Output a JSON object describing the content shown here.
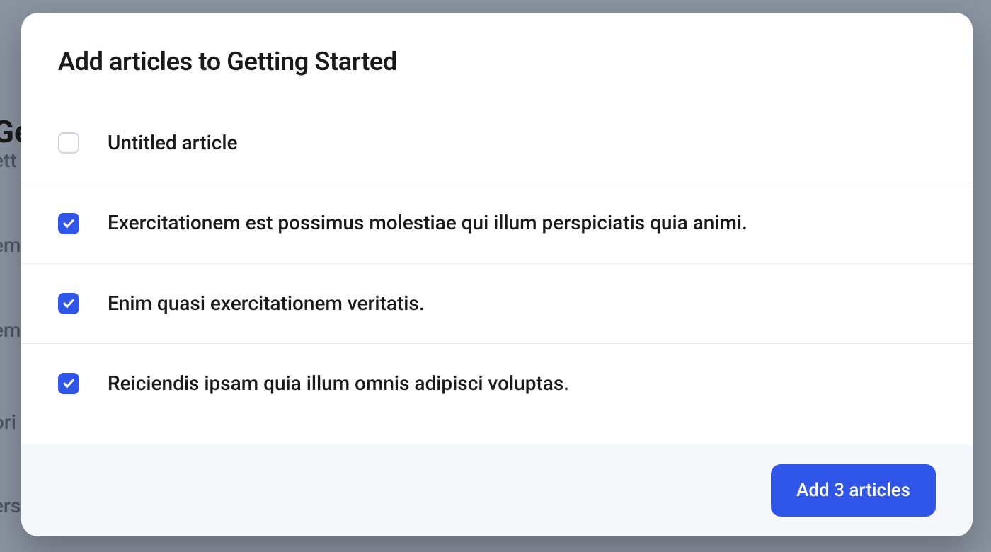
{
  "dialog": {
    "title": "Add articles to Getting Started"
  },
  "articles": [
    {
      "title": "Untitled article",
      "checked": false
    },
    {
      "title": "Exercitationem est possimus molestiae qui illum perspiciatis quia animi.",
      "checked": true
    },
    {
      "title": "Enim quasi exercitationem veritatis.",
      "checked": true
    },
    {
      "title": "Reiciendis ipsam quia illum omnis adipisci voluptas.",
      "checked": true
    }
  ],
  "footer": {
    "add_button_label": "Add 3 articles"
  },
  "backdrop": {
    "heading": "Ge",
    "line1": "ett",
    "line2": "em",
    "line3": "em",
    "line4": "ori",
    "line5": "ers"
  },
  "colors": {
    "primary": "#2f55e9",
    "border": "#e5e7eb",
    "footer_bg": "#f5f7fa"
  }
}
